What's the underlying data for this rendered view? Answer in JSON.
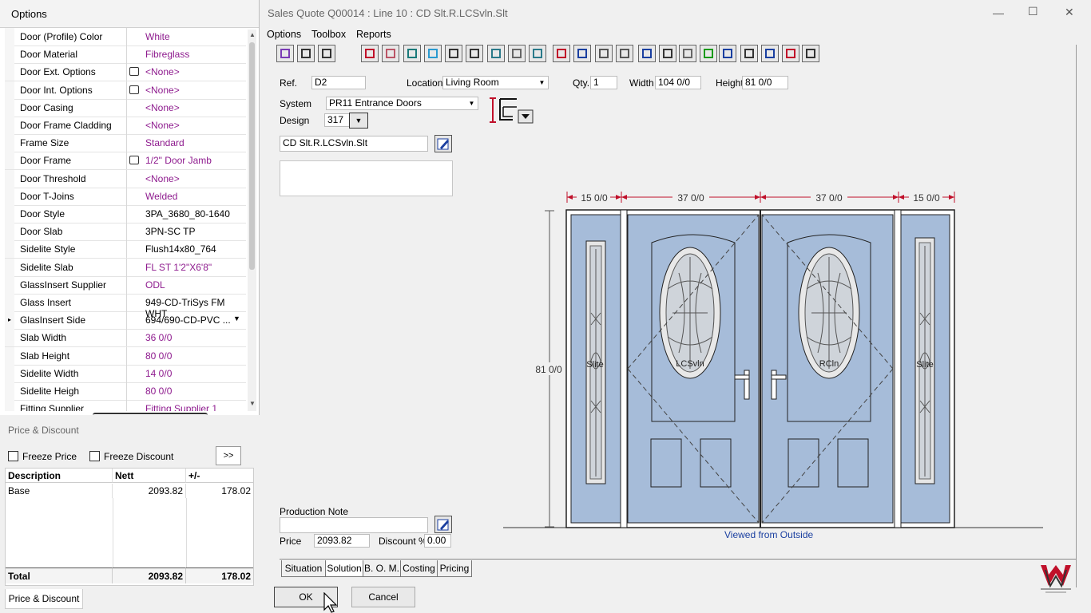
{
  "options_panel": {
    "title": "Options",
    "rows": [
      {
        "name": "Door (Profile) Color",
        "value": "White",
        "purple": true,
        "icon": false,
        "gutter": ""
      },
      {
        "name": "Door Material",
        "value": "Fibreglass",
        "purple": true,
        "icon": false,
        "gutter": ""
      },
      {
        "name": "Door Ext. Options",
        "value": "<None>",
        "purple": true,
        "icon": true,
        "gutter": ""
      },
      {
        "name": "Door Int. Options",
        "value": "<None>",
        "purple": true,
        "icon": true,
        "gutter": ""
      },
      {
        "name": "Door Casing",
        "value": "<None>",
        "purple": true,
        "icon": false,
        "gutter": ""
      },
      {
        "name": "Door Frame Cladding",
        "value": "<None>",
        "purple": true,
        "icon": false,
        "gutter": ""
      },
      {
        "name": "Frame Size",
        "value": "Standard",
        "purple": true,
        "icon": false,
        "gutter": ""
      },
      {
        "name": "Door Frame",
        "value": "1/2\" Door Jamb",
        "purple": true,
        "icon": true,
        "gutter": ""
      },
      {
        "name": "Door Threshold",
        "value": "<None>",
        "purple": true,
        "icon": false,
        "gutter": ""
      },
      {
        "name": "Door T-Joins",
        "value": "Welded",
        "purple": true,
        "icon": false,
        "gutter": ""
      },
      {
        "name": "Door Style",
        "value": "3PA_3680_80-1640",
        "purple": false,
        "icon": false,
        "gutter": ""
      },
      {
        "name": "Door Slab",
        "value": "3PN-SC TP",
        "purple": false,
        "icon": false,
        "gutter": ""
      },
      {
        "name": "Sidelite Style",
        "value": "Flush14x80_764",
        "purple": false,
        "icon": false,
        "gutter": ""
      },
      {
        "name": "Sidelite Slab",
        "value": "FL ST 1'2\"X6'8\"",
        "purple": true,
        "icon": false,
        "gutter": ""
      },
      {
        "name": "GlassInsert Supplier",
        "value": "ODL",
        "purple": true,
        "icon": false,
        "gutter": ""
      },
      {
        "name": "Glass Insert",
        "value": "949-CD-TriSys FM WHT",
        "purple": false,
        "icon": false,
        "gutter": ""
      },
      {
        "name": "GlasInsert Side",
        "value": "694/690-CD-PVC ...",
        "purple": false,
        "icon": false,
        "gutter": "▸",
        "dropdown": true
      },
      {
        "name": "Slab Width",
        "value": "36 0/0",
        "purple": true,
        "icon": false,
        "gutter": ""
      },
      {
        "name": "Slab Height",
        "value": "80 0/0",
        "purple": true,
        "icon": false,
        "gutter": ""
      },
      {
        "name": "Sidelite Width",
        "value": "14 0/0",
        "purple": true,
        "icon": false,
        "gutter": ""
      },
      {
        "name": "Sidelite Heigh",
        "value": "80 0/0",
        "purple": true,
        "icon": false,
        "gutter": ""
      },
      {
        "name": "Fitting Supplier",
        "value": "Fitting Supplier 1",
        "purple": true,
        "icon": false,
        "gutter": ""
      }
    ]
  },
  "price_discount": {
    "title": "Price & Discount",
    "freeze_price": "Freeze Price",
    "freeze_discount": "Freeze Discount",
    "expand_label": ">>",
    "columns": [
      "Description",
      "Nett",
      "+/-"
    ],
    "rows": [
      {
        "description": "Base",
        "nett": "2093.82",
        "adj": "178.02"
      }
    ],
    "total": {
      "label": "Total",
      "nett": "2093.82",
      "adj": "178.02"
    },
    "tab_label": "Price & Discount"
  },
  "window": {
    "title": "Sales Quote Q00014  : Line  10 : CD Slt.R.LCSvln.Slt",
    "minimize": "—",
    "maximize": "☐",
    "close": "✕",
    "menu": [
      "Options",
      "Toolbox",
      "Reports"
    ]
  },
  "form": {
    "ref_label": "Ref.",
    "ref_value": "D2",
    "location_label": "Location",
    "location_value": "Living Room",
    "qty_label": "Qty.",
    "qty_value": "1",
    "width_label": "Width",
    "width_value": "104 0/0",
    "height_label": "Height",
    "height_value": "81 0/0",
    "system_label": "System",
    "system_value": "PR11  Entrance Doors",
    "design_label": "Design",
    "design_value": "317",
    "name_value": "CD Slt.R.LCSvln.Slt",
    "production_note_label": "Production Note",
    "production_note_value": "",
    "price_label": "Price",
    "price_value": "2093.82",
    "discount_label": "Discount %",
    "discount_value": "0.00"
  },
  "drawing": {
    "dims_top": [
      "15 0/0",
      "37 0/0",
      "37 0/0",
      "15 0/0"
    ],
    "dim_height": "81 0/0",
    "panel_labels": [
      "Slite",
      "LCSvln",
      "RCln",
      "Slite"
    ],
    "viewed_label": "Viewed from Outside",
    "colors": {
      "glass": "#a6bcd9",
      "dim": "#c0102a",
      "frame": "#2a2a2a"
    }
  },
  "tabs": [
    "Situation",
    "Solution",
    "B. O. M.",
    "Costing",
    "Pricing"
  ],
  "active_tab": "Solution",
  "buttons": {
    "ok": "OK",
    "cancel": "Cancel"
  },
  "toolbar_icons": [
    "wizard-icon",
    "grid-icon",
    "split-icon",
    "insert-icon",
    "insert2-icon",
    "mullion-icon",
    "glass-icon",
    "lock-icon",
    "list-icon",
    "move-icon",
    "panel-icon",
    "panel2-icon",
    "delete-icon",
    "undo-icon",
    "align-icon",
    "align2-icon",
    "zoom-icon",
    "rotate-icon",
    "measure-icon",
    "add-icon",
    "tag-icon",
    "table-icon",
    "save-icon",
    "picture-icon",
    "exit-icon"
  ]
}
